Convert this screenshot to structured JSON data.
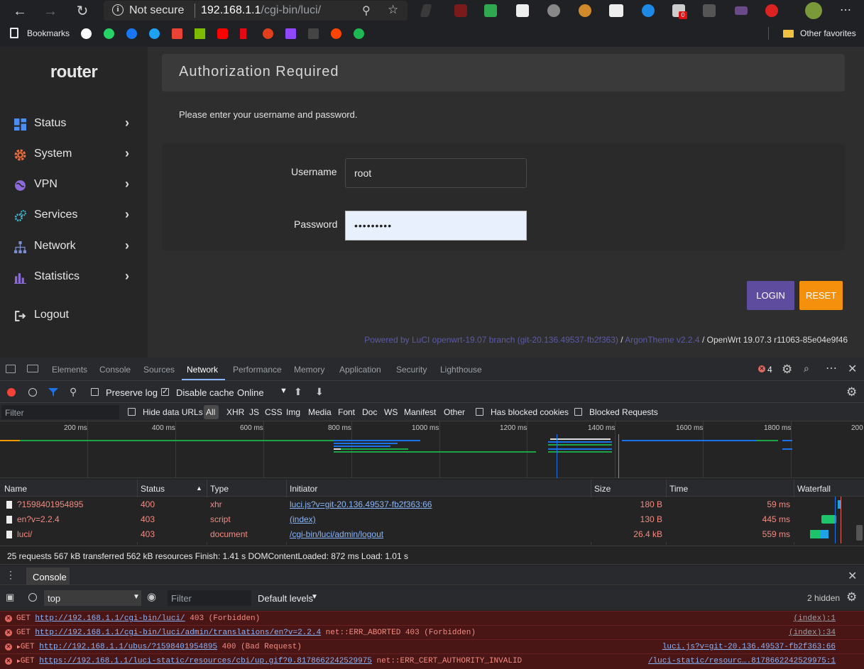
{
  "browser": {
    "security_label": "Not secure",
    "url_host": "192.168.1.1",
    "url_path": "/cgi-bin/luci/",
    "bookmarks_label": "Bookmarks",
    "other_favorites_label": "Other favorites",
    "badge_count": "0"
  },
  "sidebar": {
    "logo": "router",
    "items": [
      {
        "label": "Status",
        "icon": "dashboard-icon",
        "color": "#4b8ef0"
      },
      {
        "label": "System",
        "icon": "gear-icon",
        "color": "#f06b3a"
      },
      {
        "label": "VPN",
        "icon": "globe-icon",
        "color": "#8b6bd9"
      },
      {
        "label": "Services",
        "icon": "cogs-icon",
        "color": "#3ab8d0"
      },
      {
        "label": "Network",
        "icon": "sitemap-icon",
        "color": "#7b8fd0"
      },
      {
        "label": "Statistics",
        "icon": "bar-chart-icon",
        "color": "#8b6bd9"
      }
    ],
    "logout_label": "Logout"
  },
  "auth": {
    "title": "Authorization Required",
    "prompt": "Please enter your username and password.",
    "username_label": "Username",
    "username_value": "root",
    "password_label": "Password",
    "password_value": "•••••••••",
    "login_label": "LOGIN",
    "reset_label": "RESET",
    "footer_luci": "Powered by LuCI openwrt-19.07 branch (git-20.136.49537-fb2f363)",
    "footer_sep1": " / ",
    "footer_theme": "ArgonTheme v2.2.4",
    "footer_sep2": " / ",
    "footer_openwrt": "OpenWrt 19.07.3 r11063-85e04e9f46"
  },
  "devtools": {
    "tabs": [
      "Elements",
      "Console",
      "Sources",
      "Network",
      "Performance",
      "Memory",
      "Application",
      "Security",
      "Lighthouse"
    ],
    "active_tab": "Network",
    "error_count": "4",
    "preserve_log": "Preserve log",
    "disable_cache": "Disable cache",
    "throttling": "Online",
    "filter_placeholder": "Filter",
    "hide_data_urls": "Hide data URLs",
    "type_filters": [
      "All",
      "XHR",
      "JS",
      "CSS",
      "Img",
      "Media",
      "Font",
      "Doc",
      "WS",
      "Manifest",
      "Other"
    ],
    "has_blocked_cookies": "Has blocked cookies",
    "blocked_requests": "Blocked Requests",
    "timeline_ticks": [
      "200 ms",
      "400 ms",
      "600 ms",
      "800 ms",
      "1000 ms",
      "1200 ms",
      "1400 ms",
      "1600 ms",
      "1800 ms",
      "200"
    ],
    "columns": [
      "Name",
      "Status",
      "Type",
      "Initiator",
      "Size",
      "Time",
      "Waterfall"
    ],
    "rows": [
      {
        "name": "?1598401954895",
        "status": "400",
        "type": "xhr",
        "initiator": "luci.js?v=git-20.136.49537-fb2f363:66",
        "size": "180 B",
        "time": "59 ms"
      },
      {
        "name": "en?v=2.2.4",
        "status": "403",
        "type": "script",
        "initiator": "(index)",
        "size": "130 B",
        "time": "445 ms"
      },
      {
        "name": "luci/",
        "status": "403",
        "type": "document",
        "initiator": "/cgi-bin/luci/admin/logout",
        "size": "26.4 kB",
        "time": "559 ms"
      }
    ],
    "summary": "25 requests  567 kB transferred  562 kB resources  Finish: 1.41 s  DOMContentLoaded: 872 ms  Load: 1.01 s",
    "drawer_tab": "Console",
    "console_context": "top",
    "console_filter_placeholder": "Filter",
    "default_levels": "Default levels",
    "hidden_count": "2 hidden",
    "console_lines": [
      {
        "prefix": "GET ",
        "url": "http://192.168.1.1/cgi-bin/luci/",
        "suffix": " 403 (Forbidden)",
        "source": "(index):1",
        "expandable": false
      },
      {
        "prefix": "GET ",
        "url": "http://192.168.1.1/cgi-bin/luci/admin/translations/en?v=2.2.4",
        "suffix": " net::ERR_ABORTED 403 (Forbidden)",
        "source": "(index):34",
        "expandable": false
      },
      {
        "prefix": "GET ",
        "url": "http://192.168.1.1/ubus/?1598401954895",
        "suffix": " 400 (Bad Request)",
        "source": "luci.js?v=git-20.136.49537-fb2f363:66",
        "expandable": true
      },
      {
        "prefix": "GET ",
        "url": "https://192.168.1.1/luci-static/resources/cbi/up.gif?0.8178662242529975",
        "suffix": " net::ERR_CERT_AUTHORITY_INVALID",
        "source": "/luci-static/resourc….8178662242529975:1",
        "expandable": true
      }
    ]
  }
}
